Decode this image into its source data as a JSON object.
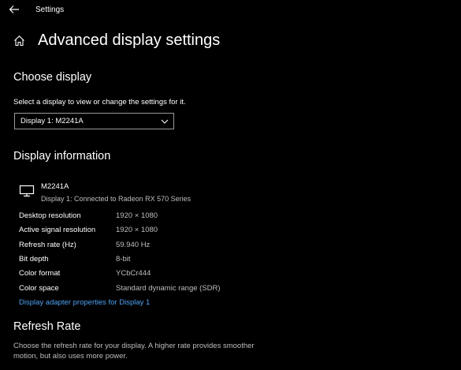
{
  "titlebar": {
    "app_title": "Settings",
    "back_icon": "back-arrow-icon"
  },
  "header": {
    "home_icon": "home-icon",
    "title": "Advanced display settings"
  },
  "choose_display": {
    "heading": "Choose display",
    "instruction": "Select a display to view or change the settings for it.",
    "selected_display": "Display 1: M2241A"
  },
  "display_information": {
    "heading": "Display information",
    "monitor_icon": "monitor-icon",
    "monitor_name": "M2241A",
    "monitor_connection": "Display 1: Connected to Radeon RX 570 Series",
    "rows": [
      {
        "label": "Desktop resolution",
        "value": "1920 × 1080"
      },
      {
        "label": "Active signal resolution",
        "value": "1920 × 1080"
      },
      {
        "label": "Refresh rate (Hz)",
        "value": "59.940 Hz"
      },
      {
        "label": "Bit depth",
        "value": "8-bit"
      },
      {
        "label": "Color format",
        "value": "YCbCr444"
      },
      {
        "label": "Color space",
        "value": "Standard dynamic range (SDR)"
      }
    ],
    "adapter_link": "Display adapter properties for Display 1"
  },
  "refresh_rate": {
    "heading": "Refresh Rate",
    "description": "Choose the refresh rate for your display. A higher rate provides smoother motion, but also uses more power."
  },
  "colors": {
    "background": "#000000",
    "text": "#ffffff",
    "secondary_text": "#bdbdbd",
    "link": "#4ea1f3"
  }
}
